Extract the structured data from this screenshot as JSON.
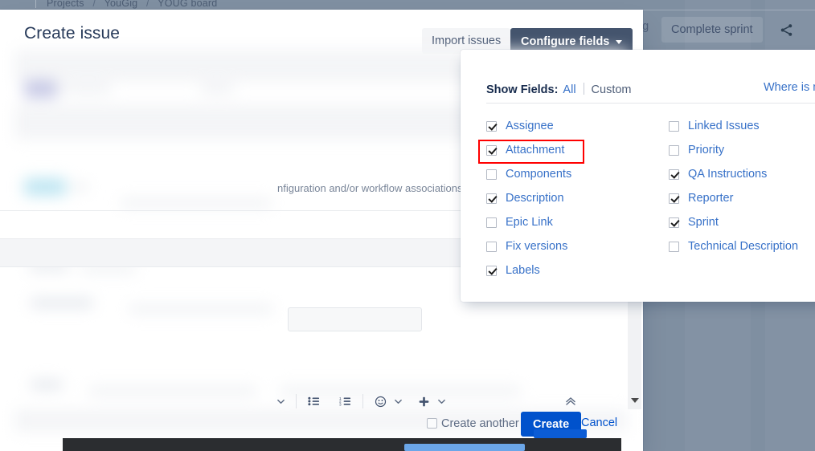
{
  "background": {
    "breadcrumb": [
      "Projects",
      "YouGig",
      "YOUG board"
    ],
    "separator": "/",
    "partial_word": "ng",
    "complete_sprint_label": "Complete sprint",
    "share_icon": "share-icon",
    "board_bg_color": "#7f8fa1"
  },
  "modal": {
    "title": "Create issue",
    "import_issues_label": "Import issues",
    "configure_fields_label": "Configure fields",
    "configure_fields_color": "#44546d",
    "helper_text": "nfiguration and/or workflow associations",
    "editor_toolbar": {
      "icons": [
        "chevron-down-icon",
        "bullet-list-icon",
        "numbered-list-icon",
        "emoji-icon",
        "emoji-chevron-icon",
        "plus-icon",
        "plus-chevron-icon",
        "collapse-toolbar-icon"
      ]
    },
    "footer": {
      "create_another_label": "Create another",
      "create_another_checked": false,
      "create_label": "Create",
      "create_color": "#0052cc",
      "cancel_label": "Cancel"
    }
  },
  "popup": {
    "show_fields_label": "Show Fields:",
    "tab_all": "All",
    "tab_custom": "Custom",
    "active_tab": "All",
    "where_is_my_field_label": "Where is my fie",
    "highlight_color": "#ff0000",
    "highlighted_field": "Attachment",
    "columns": {
      "left": [
        {
          "label": "Assignee",
          "checked": true
        },
        {
          "label": "Attachment",
          "checked": true
        },
        {
          "label": "Components",
          "checked": false
        },
        {
          "label": "Description",
          "checked": true
        },
        {
          "label": "Epic Link",
          "checked": false
        },
        {
          "label": "Fix versions",
          "checked": false
        },
        {
          "label": "Labels",
          "checked": true
        }
      ],
      "right": [
        {
          "label": "Linked Issues",
          "checked": false
        },
        {
          "label": "Priority",
          "checked": false
        },
        {
          "label": "QA Instructions",
          "checked": true
        },
        {
          "label": "Reporter",
          "checked": true
        },
        {
          "label": "Sprint",
          "checked": true
        },
        {
          "label": "Technical Description",
          "checked": false
        }
      ]
    }
  }
}
